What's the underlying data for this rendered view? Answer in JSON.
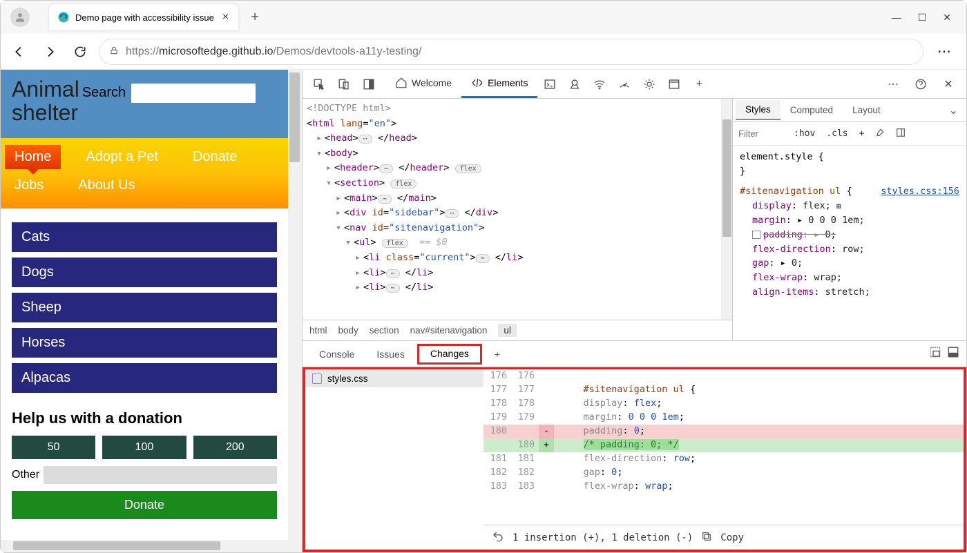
{
  "browser": {
    "tab_title": "Demo page with accessibility issue",
    "url_grey_prefix": "https://",
    "url_host": "microsoftedge.github.io",
    "url_path": "/Demos/devtools-a11y-testing/"
  },
  "page": {
    "site_title_line1": "Animal",
    "site_title_line2": "shelter",
    "search_label": "Search",
    "nav": [
      "Home",
      "Adopt a Pet",
      "Donate",
      "Jobs",
      "About Us"
    ],
    "nav_current": "Home",
    "categories": [
      "Cats",
      "Dogs",
      "Sheep",
      "Horses",
      "Alpacas"
    ],
    "donation_heading": "Help us with a donation",
    "donation_amounts": [
      "50",
      "100",
      "200"
    ],
    "other_label": "Other",
    "donate_button": "Donate"
  },
  "devtools": {
    "tabs": {
      "welcome": "Welcome",
      "elements": "Elements"
    },
    "dom": {
      "doctype": "<!DOCTYPE html>",
      "html_open": "<html",
      "html_lang_attr": "lang",
      "html_lang_val": "\"en\"",
      "head": "head",
      "body": "body",
      "header": "header",
      "flex_pill": "flex",
      "section": "section",
      "main": "main",
      "div": "div",
      "id_attr": "id",
      "sidebar_val": "\"sidebar\"",
      "nav": "nav",
      "sitenav_val": "\"sitenavigation\"",
      "ul": "ul",
      "eq0": "== $0",
      "li": "li",
      "class_attr": "class",
      "current_val": "\"current\""
    },
    "breadcrumbs": [
      "html",
      "body",
      "section",
      "nav#sitenavigation",
      "ul"
    ],
    "styles": {
      "tabs": {
        "styles": "Styles",
        "computed": "Computed",
        "layout": "Layout"
      },
      "filter_placeholder": "Filter",
      "hov": ":hov",
      "cls": ".cls",
      "element_style": "element.style {",
      "close_brace": "}",
      "rule_selector": "#sitenavigation ul",
      "rule_open": " {",
      "rule_link": "styles.css:156",
      "props": [
        {
          "name": "display",
          "val": "flex;",
          "struck": false,
          "has_grid_icon": true
        },
        {
          "name": "margin",
          "val": "0 0 0 1em;",
          "struck": false,
          "has_arrow": true
        },
        {
          "name": "padding",
          "val": "0;",
          "struck": true,
          "checkbox": true,
          "has_arrow": true
        },
        {
          "name": "flex-direction",
          "val": "row;",
          "struck": false
        },
        {
          "name": "gap",
          "val": "0;",
          "struck": false,
          "has_arrow": true
        },
        {
          "name": "flex-wrap",
          "val": "wrap;",
          "struck": false
        },
        {
          "name": "align-items",
          "val": "stretch;",
          "struck": false
        }
      ]
    },
    "drawer": {
      "tabs": {
        "console": "Console",
        "issues": "Issues",
        "changes": "Changes"
      },
      "file": "styles.css",
      "diff": [
        {
          "l": "176",
          "r": "176",
          "mark": "",
          "code": ""
        },
        {
          "l": "177",
          "r": "177",
          "mark": "",
          "code_sel": "#sitenavigation ul",
          "code_rest": " {"
        },
        {
          "l": "178",
          "r": "178",
          "mark": "",
          "code_prop": "display",
          "code_val": "flex",
          "sep": ": ",
          "end": ";"
        },
        {
          "l": "179",
          "r": "179",
          "mark": "",
          "code_prop": "margin",
          "code_val": "0 0 0 1em",
          "sep": ": ",
          "end": ";"
        },
        {
          "l": "180",
          "r": "",
          "mark": "-",
          "cls": "del",
          "code_prop": "padding",
          "code_val": "0",
          "sep": ": ",
          "end": ";"
        },
        {
          "l": "",
          "r": "180",
          "mark": "+",
          "cls": "add",
          "code_comment": "/* padding: 0; */"
        },
        {
          "l": "181",
          "r": "181",
          "mark": "",
          "code_prop": "flex-direction",
          "code_val": "row",
          "sep": ": ",
          "end": ";"
        },
        {
          "l": "182",
          "r": "182",
          "mark": "",
          "code_prop": "gap",
          "code_val": "0",
          "sep": ": ",
          "end": ";"
        },
        {
          "l": "183",
          "r": "183",
          "mark": "",
          "code_prop": "flex-wrap",
          "code_val": "wrap",
          "sep": ": ",
          "end": ";"
        }
      ],
      "status": "1 insertion (+), 1 deletion (-)",
      "copy": "Copy"
    }
  }
}
